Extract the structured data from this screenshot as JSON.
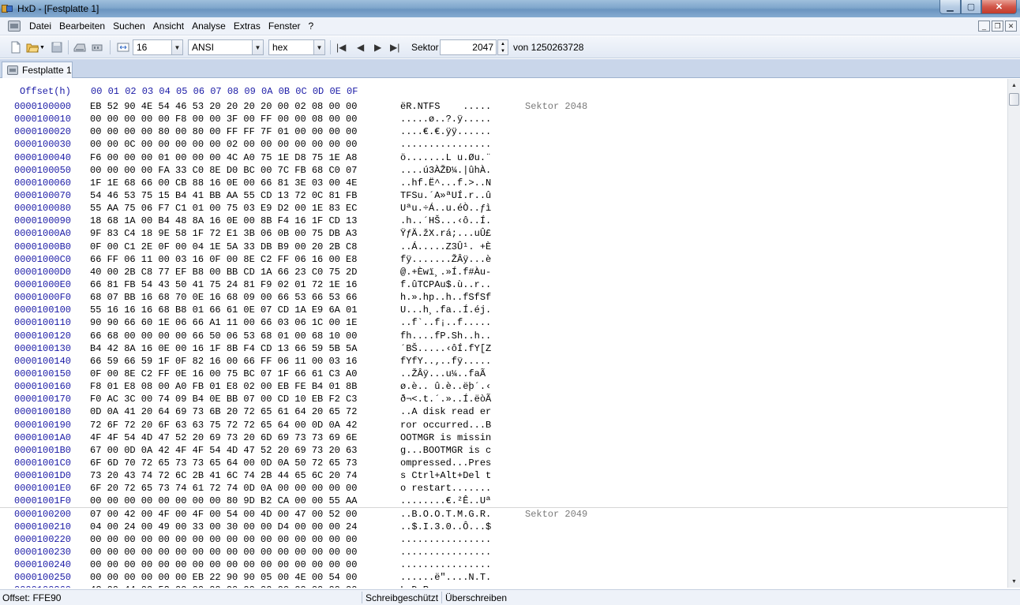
{
  "window": {
    "title": "HxD - [Festplatte 1]"
  },
  "menu": [
    "Datei",
    "Bearbeiten",
    "Suchen",
    "Ansicht",
    "Analyse",
    "Extras",
    "Fenster",
    "?"
  ],
  "toolbar": {
    "bytes_per_row": "16",
    "charset": "ANSI",
    "display_mode": "hex",
    "sector_label": "Sektor",
    "sector_value": "2047",
    "sector_total": "von 1250263728"
  },
  "tabs": [
    {
      "label": "Festplatte 1"
    }
  ],
  "editor": {
    "offset_header": "Offset(h)",
    "byte_header": "00 01 02 03 04 05 06 07 08 09 0A 0B 0C 0D 0E 0F",
    "rows": [
      {
        "offset": "0000100000",
        "hex": "EB 52 90 4E 54 46 53 20 20 20 20 00 02 08 00 00",
        "ascii": "ëR.NTFS    .....",
        "sector": "Sektor 2048"
      },
      {
        "offset": "0000100010",
        "hex": "00 00 00 00 00 F8 00 00 3F 00 FF 00 00 08 00 00",
        "ascii": ".....ø..?.ÿ....."
      },
      {
        "offset": "0000100020",
        "hex": "00 00 00 00 80 00 80 00 FF FF 7F 01 00 00 00 00",
        "ascii": "....€.€.ÿÿ......"
      },
      {
        "offset": "0000100030",
        "hex": "00 00 0C 00 00 00 00 00 02 00 00 00 00 00 00 00",
        "ascii": "................"
      },
      {
        "offset": "0000100040",
        "hex": "F6 00 00 00 01 00 00 00 4C A0 75 1E D8 75 1E A8",
        "ascii": "ö.......L u.Øu.¨"
      },
      {
        "offset": "0000100050",
        "hex": "00 00 00 00 FA 33 C0 8E D0 BC 00 7C FB 68 C0 07",
        "ascii": "....ú3ÀŽĐ¼.|ûhÀ."
      },
      {
        "offset": "0000100060",
        "hex": "1F 1E 68 66 00 CB 88 16 0E 00 66 81 3E 03 00 4E",
        "ascii": "..hf.Ë^...f.>..N"
      },
      {
        "offset": "0000100070",
        "hex": "54 46 53 75 15 B4 41 BB AA 55 CD 13 72 0C 81 FB",
        "ascii": "TFSu.´A»ªUÍ.r..û"
      },
      {
        "offset": "0000100080",
        "hex": "55 AA 75 06 F7 C1 01 00 75 03 E9 D2 00 1E 83 EC",
        "ascii": "Uªu.÷Á..u.éÒ..ƒì"
      },
      {
        "offset": "0000100090",
        "hex": "18 68 1A 00 B4 48 8A 16 0E 00 8B F4 16 1F CD 13",
        "ascii": ".h..´HŠ...‹ô..Í."
      },
      {
        "offset": "00001000A0",
        "hex": "9F 83 C4 18 9E 58 1F 72 E1 3B 06 0B 00 75 DB A3",
        "ascii": "ŸƒÄ.žX.rá;...uÛ£"
      },
      {
        "offset": "00001000B0",
        "hex": "0F 00 C1 2E 0F 00 04 1E 5A 33 DB B9 00 20 2B C8",
        "ascii": "..Á.....Z3Û¹. +È"
      },
      {
        "offset": "00001000C0",
        "hex": "66 FF 06 11 00 03 16 0F 00 8E C2 FF 06 16 00 E8",
        "ascii": "fÿ.......ŽÂÿ...è"
      },
      {
        "offset": "00001000D0",
        "hex": "40 00 2B C8 77 EF B8 00 BB CD 1A 66 23 C0 75 2D",
        "ascii": "@.+Èwï¸.»Í.f#Àu-"
      },
      {
        "offset": "00001000E0",
        "hex": "66 81 FB 54 43 50 41 75 24 81 F9 02 01 72 1E 16",
        "ascii": "f.ûTCPAu$.ù..r.."
      },
      {
        "offset": "00001000F0",
        "hex": "68 07 BB 16 68 70 0E 16 68 09 00 66 53 66 53 66",
        "ascii": "h.».hp..h..fSfSf"
      },
      {
        "offset": "0000100100",
        "hex": "55 16 16 16 68 B8 01 66 61 0E 07 CD 1A E9 6A 01",
        "ascii": "U...h¸.fa..Í.éj."
      },
      {
        "offset": "0000100110",
        "hex": "90 90 66 60 1E 06 66 A1 11 00 66 03 06 1C 00 1E",
        "ascii": "..f`..f¡..f....."
      },
      {
        "offset": "0000100120",
        "hex": "66 68 00 00 00 00 66 50 06 53 68 01 00 68 10 00",
        "ascii": "fh....fP.Sh..h.."
      },
      {
        "offset": "0000100130",
        "hex": "B4 42 8A 16 0E 00 16 1F 8B F4 CD 13 66 59 5B 5A",
        "ascii": "´BŠ.....‹ôÍ.fY[Z"
      },
      {
        "offset": "0000100140",
        "hex": "66 59 66 59 1F 0F 82 16 00 66 FF 06 11 00 03 16",
        "ascii": "fYfY..‚..fÿ....."
      },
      {
        "offset": "0000100150",
        "hex": "0F 00 8E C2 FF 0E 16 00 75 BC 07 1F 66 61 C3 A0",
        "ascii": "..ŽÂÿ...u¼..faÃ "
      },
      {
        "offset": "0000100160",
        "hex": "F8 01 E8 08 00 A0 FB 01 E8 02 00 EB FE B4 01 8B",
        "ascii": "ø.è.. û.è..ëþ´.‹"
      },
      {
        "offset": "0000100170",
        "hex": "F0 AC 3C 00 74 09 B4 0E BB 07 00 CD 10 EB F2 C3",
        "ascii": "ð¬<.t.´.»..Í.ëòÃ"
      },
      {
        "offset": "0000100180",
        "hex": "0D 0A 41 20 64 69 73 6B 20 72 65 61 64 20 65 72",
        "ascii": "..A disk read er"
      },
      {
        "offset": "0000100190",
        "hex": "72 6F 72 20 6F 63 63 75 72 72 65 64 00 0D 0A 42",
        "ascii": "ror occurred...B"
      },
      {
        "offset": "00001001A0",
        "hex": "4F 4F 54 4D 47 52 20 69 73 20 6D 69 73 73 69 6E",
        "ascii": "OOTMGR is missin"
      },
      {
        "offset": "00001001B0",
        "hex": "67 00 0D 0A 42 4F 4F 54 4D 47 52 20 69 73 20 63",
        "ascii": "g...BOOTMGR is c"
      },
      {
        "offset": "00001001C0",
        "hex": "6F 6D 70 72 65 73 73 65 64 00 0D 0A 50 72 65 73",
        "ascii": "ompressed...Pres"
      },
      {
        "offset": "00001001D0",
        "hex": "73 20 43 74 72 6C 2B 41 6C 74 2B 44 65 6C 20 74",
        "ascii": "s Ctrl+Alt+Del t"
      },
      {
        "offset": "00001001E0",
        "hex": "6F 20 72 65 73 74 61 72 74 0D 0A 00 00 00 00 00",
        "ascii": "o restart......."
      },
      {
        "offset": "00001001F0",
        "hex": "00 00 00 00 00 00 00 00 80 9D B2 CA 00 00 55 AA",
        "ascii": "........€.²Ê..Uª"
      },
      {
        "offset": "0000100200",
        "hex": "07 00 42 00 4F 00 4F 00 54 00 4D 00 47 00 52 00",
        "ascii": "..B.O.O.T.M.G.R.",
        "sector": "Sektor 2049"
      },
      {
        "offset": "0000100210",
        "hex": "04 00 24 00 49 00 33 00 30 00 00 D4 00 00 00 24",
        "ascii": "..$.I.3.0..Ô...$"
      },
      {
        "offset": "0000100220",
        "hex": "00 00 00 00 00 00 00 00 00 00 00 00 00 00 00 00",
        "ascii": "................"
      },
      {
        "offset": "0000100230",
        "hex": "00 00 00 00 00 00 00 00 00 00 00 00 00 00 00 00",
        "ascii": "................"
      },
      {
        "offset": "0000100240",
        "hex": "00 00 00 00 00 00 00 00 00 00 00 00 00 00 00 00",
        "ascii": "................"
      },
      {
        "offset": "0000100250",
        "hex": "00 00 00 00 00 00 EB 22 90 90 05 00 4E 00 54 00",
        "ascii": "......ë\"....N.T."
      },
      {
        "offset": "0000100260",
        "hex": "4C 00 44 00 52 00 00 00 00 00 00 00 00 00 00 00",
        "ascii": "L.D.R..........."
      }
    ]
  },
  "status": {
    "offset": "Offset: FFE90",
    "readonly": "Schreibgeschützt",
    "mode": "Überschreiben"
  }
}
